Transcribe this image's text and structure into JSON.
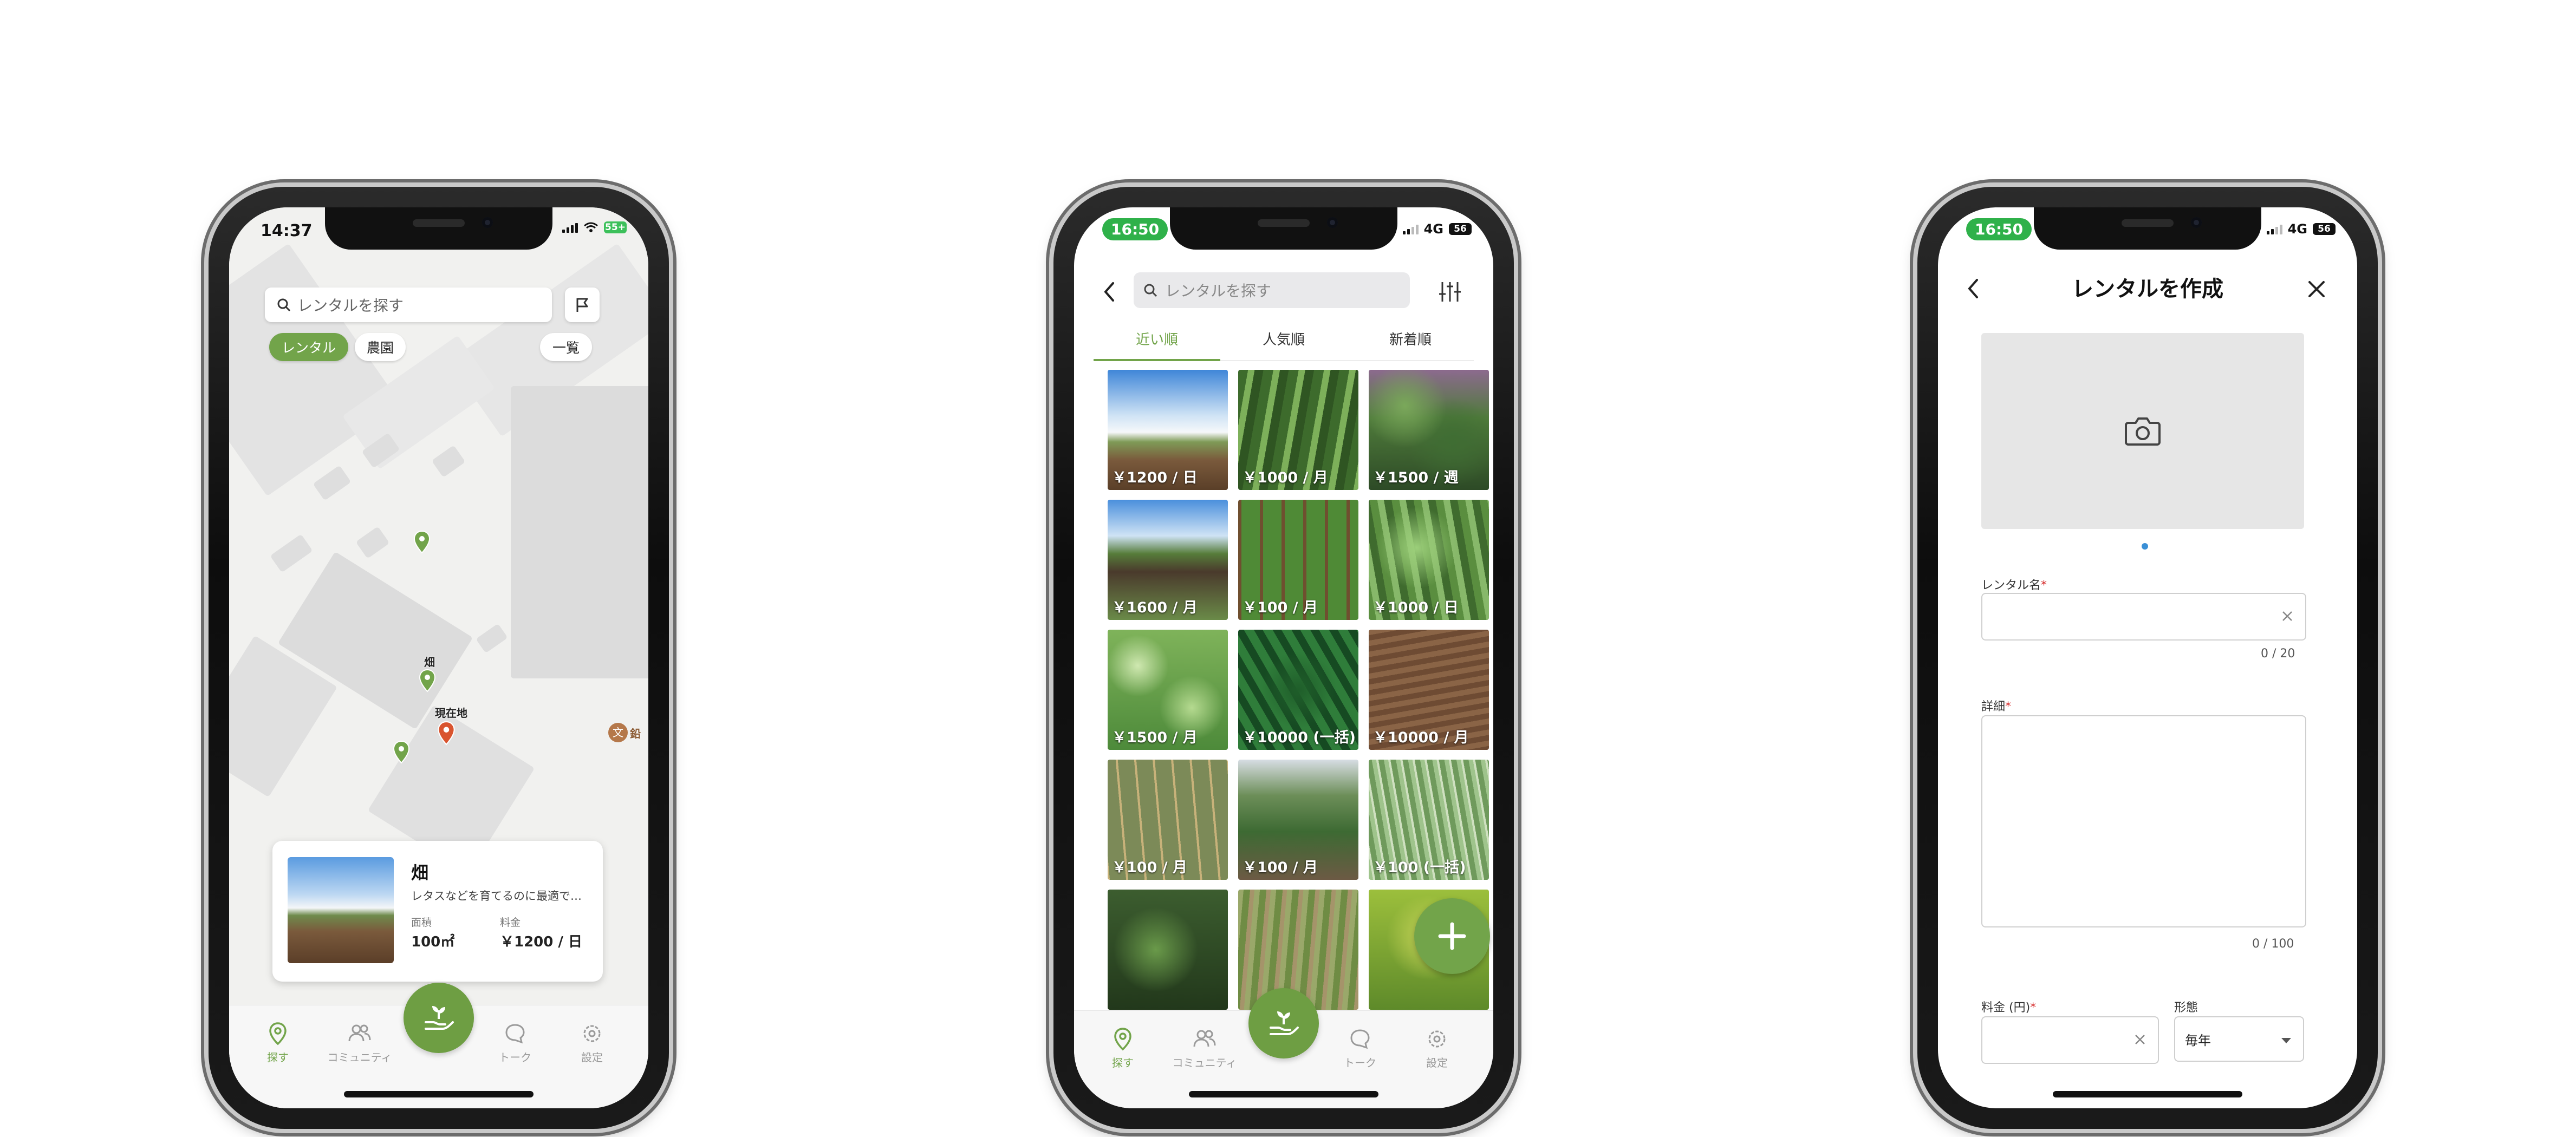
{
  "screen1": {
    "status": {
      "time": "14:37",
      "battery": "55+"
    },
    "search_placeholder": "レンタルを探す",
    "filters": {
      "rental": "レンタル",
      "farm": "農園",
      "list": "一覧"
    },
    "map_labels": {
      "field": "畑",
      "current": "現在地",
      "poi": "鉛"
    },
    "card": {
      "title": "畑",
      "desc": "レタスなどを育てるのに最適で…",
      "area_label": "面積",
      "area_value": "100㎡",
      "fee_label": "料金",
      "fee_value": "￥1200 / 日"
    }
  },
  "screen2": {
    "status": {
      "time": "16:50",
      "network": "4G",
      "battery": "56"
    },
    "search_placeholder": "レンタルを探す",
    "sort_tabs": [
      "近い順",
      "人気順",
      "新着順"
    ],
    "tiles": [
      {
        "price": "￥1200 / 日",
        "kind": "sky"
      },
      {
        "price": "￥1000 / 月",
        "kind": "green"
      },
      {
        "price": "￥1500 / 週",
        "kind": "leafy"
      },
      {
        "price": "￥1600 / 月",
        "kind": "skyfield"
      },
      {
        "price": "￥100 / 月",
        "kind": "trellis"
      },
      {
        "price": "￥1000 / 日",
        "kind": "vines"
      },
      {
        "price": "￥1500 / 月",
        "kind": "cabbage"
      },
      {
        "price": "￥10000 (一括)",
        "kind": "darkleaf"
      },
      {
        "price": "￥10000 / 月",
        "kind": "soil"
      },
      {
        "price": "￥100 / 月",
        "kind": "poles"
      },
      {
        "price": "￥100 / 月",
        "kind": "path"
      },
      {
        "price": "￥100 (一括)",
        "kind": "onion"
      },
      {
        "price": "",
        "kind": "shade"
      },
      {
        "price": "",
        "kind": "rows"
      },
      {
        "price": "",
        "kind": "bright"
      }
    ]
  },
  "screen3": {
    "status": {
      "time": "16:50",
      "network": "4G",
      "battery": "56"
    },
    "title": "レンタルを作成",
    "name_label": "レンタル名",
    "name_counter": "0 / 20",
    "detail_label": "詳細",
    "detail_counter": "0 / 100",
    "fee_label": "料金 (円)",
    "type_label": "形態",
    "type_value": "毎年",
    "required_mark": "*"
  },
  "tabbar": [
    "探す",
    "コミュニティ",
    "トーク",
    "設定"
  ]
}
